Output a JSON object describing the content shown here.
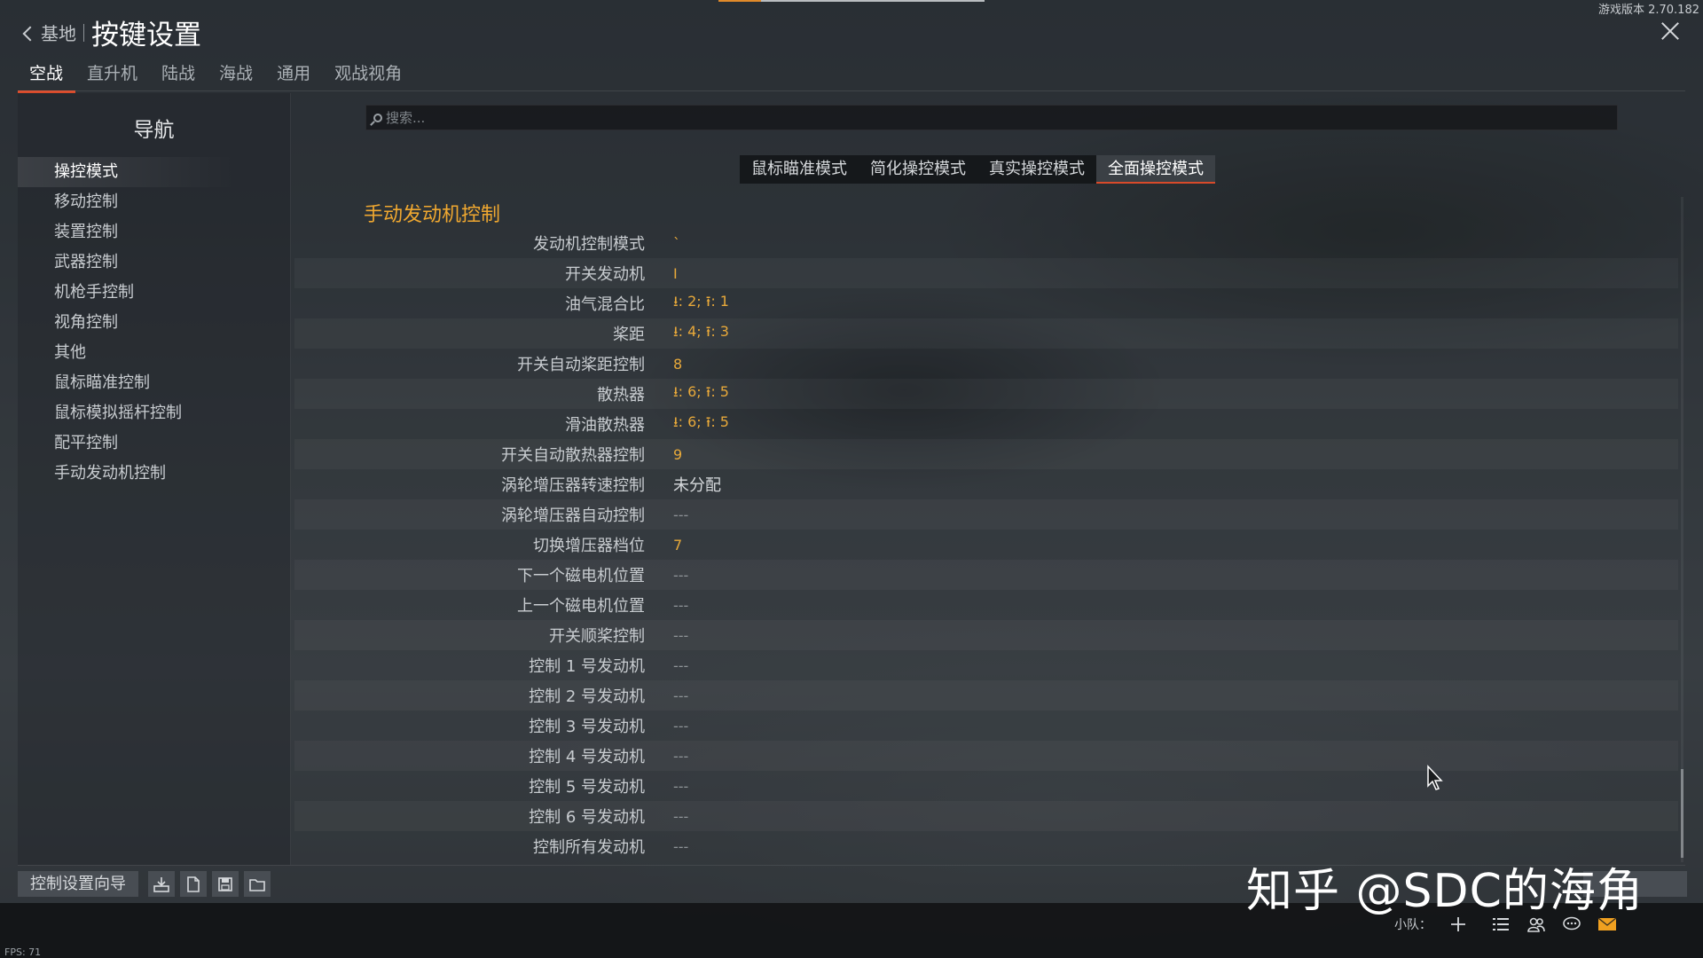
{
  "header": {
    "back_label": "基地",
    "title": "按键设置",
    "version": "游戏版本 2.70.182"
  },
  "tabs": [
    {
      "label": "空战",
      "active": true
    },
    {
      "label": "直升机"
    },
    {
      "label": "陆战"
    },
    {
      "label": "海战"
    },
    {
      "label": "通用"
    },
    {
      "label": "观战视角"
    }
  ],
  "nav": {
    "title": "导航",
    "items": [
      {
        "label": "操控模式",
        "active": true
      },
      {
        "label": "移动控制"
      },
      {
        "label": "装置控制"
      },
      {
        "label": "武器控制"
      },
      {
        "label": "机枪手控制"
      },
      {
        "label": "视角控制"
      },
      {
        "label": "其他"
      },
      {
        "label": "鼠标瞄准控制"
      },
      {
        "label": "鼠标模拟摇杆控制"
      },
      {
        "label": "配平控制"
      },
      {
        "label": "手动发动机控制"
      }
    ]
  },
  "search": {
    "placeholder": "搜索..."
  },
  "mode_tabs": [
    {
      "label": "鼠标瞄准模式"
    },
    {
      "label": "简化操控模式"
    },
    {
      "label": "真实操控模式"
    },
    {
      "label": "全面操控模式",
      "active": true
    }
  ],
  "section_title": "手动发动机控制",
  "rows": [
    {
      "label": "发动机控制模式",
      "value": "`"
    },
    {
      "label": "开关发动机",
      "value": "I"
    },
    {
      "label": "油气混合比",
      "value": "⭳: 2;  ⭱: 1"
    },
    {
      "label": "桨距",
      "value": "⭳: 4;  ⭱: 3"
    },
    {
      "label": "开关自动桨距控制",
      "value": "8"
    },
    {
      "label": "散热器",
      "value": "⭳: 6;  ⭱: 5"
    },
    {
      "label": "滑油散热器",
      "value": "⭳: 6;  ⭱: 5"
    },
    {
      "label": "开关自动散热器控制",
      "value": "9"
    },
    {
      "label": "涡轮增压器转速控制",
      "value": "未分配"
    },
    {
      "label": "涡轮增压器自动控制",
      "value": "---"
    },
    {
      "label": "切换增压器档位",
      "value": "7"
    },
    {
      "label": "下一个磁电机位置",
      "value": "---"
    },
    {
      "label": "上一个磁电机位置",
      "value": "---"
    },
    {
      "label": "开关顺桨控制",
      "value": "---"
    },
    {
      "label": "控制 1 号发动机",
      "value": "---"
    },
    {
      "label": "控制 2 号发动机",
      "value": "---"
    },
    {
      "label": "控制 3 号发动机",
      "value": "---"
    },
    {
      "label": "控制 4 号发动机",
      "value": "---"
    },
    {
      "label": "控制 5 号发动机",
      "value": "---"
    },
    {
      "label": "控制 6 号发动机",
      "value": "---"
    },
    {
      "label": "控制所有发动机",
      "value": "---"
    }
  ],
  "toolbar": {
    "wizard_label": "控制设置向导"
  },
  "status": {
    "squad_label": "小队：",
    "fps": "FPS: 71"
  },
  "watermark": "知乎 @SDC的海角",
  "colors": {
    "accent": "#d84a2a",
    "binding": "#e8a93a",
    "section_title": "#f0a830",
    "mail_icon": "#f0a020"
  }
}
